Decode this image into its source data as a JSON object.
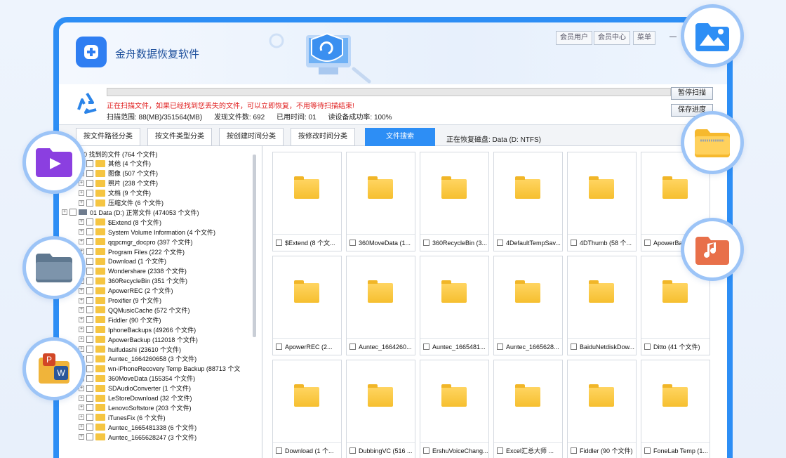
{
  "app": {
    "title": "金舟数据恢复软件"
  },
  "header_buttons": [
    "会员用户",
    "会员中心",
    "菜单"
  ],
  "scan": {
    "warning": "正在扫描文件，如果已经找到您丢失的文件，可以立即恢复，不用等待扫描结束!",
    "range": "扫描范围: 88(MB)/351564(MB)",
    "found": "发现文件数: 692",
    "elapsed": "已用时间: 01",
    "success_rate": "读设备成功率: 100%",
    "pause_label": "暂停扫描",
    "save_label": "保存进度"
  },
  "tabs": [
    {
      "label": "按文件路径分类",
      "active": false
    },
    {
      "label": "按文件类型分类",
      "active": false
    },
    {
      "label": "按创建时间分类",
      "active": false
    },
    {
      "label": "按修改时间分类",
      "active": false
    },
    {
      "label": "文件搜索",
      "active": true
    }
  ],
  "recovering_disk": "正在恢复磁盘: Data (D: NTFS)",
  "tree": [
    {
      "text": "00 找到的文件 (764 个文件)",
      "kind": "plain",
      "indent": 1
    },
    {
      "text": "其他   (4 个文件)",
      "kind": "folder",
      "indent": 2
    },
    {
      "text": "图像   (507 个文件)",
      "kind": "folder",
      "indent": 2
    },
    {
      "text": "照片   (238 个文件)",
      "kind": "folder",
      "indent": 2
    },
    {
      "text": "文档   (9 个文件)",
      "kind": "folder",
      "indent": 2
    },
    {
      "text": "压缩文件   (6 个文件)",
      "kind": "folder",
      "indent": 2
    },
    {
      "text": "01 Data (D:) 正常文件 (474053 个文件)",
      "kind": "disk",
      "indent": 0
    },
    {
      "text": "$Extend   (8 个文件)",
      "kind": "folder",
      "indent": 2
    },
    {
      "text": "System Volume Information   (4 个文件)",
      "kind": "folder",
      "indent": 2
    },
    {
      "text": "qqpcmgr_docpro   (397 个文件)",
      "kind": "folder",
      "indent": 2
    },
    {
      "text": "Program Files   (222 个文件)",
      "kind": "folder",
      "indent": 2
    },
    {
      "text": "Download   (1 个文件)",
      "kind": "folder",
      "indent": 2
    },
    {
      "text": "Wondershare   (2338 个文件)",
      "kind": "folder",
      "indent": 2
    },
    {
      "text": "360RecycleBin   (351 个文件)",
      "kind": "folder",
      "indent": 2
    },
    {
      "text": "ApowerREC   (2 个文件)",
      "kind": "folder",
      "indent": 2
    },
    {
      "text": "Proxifier   (9 个文件)",
      "kind": "folder",
      "indent": 2
    },
    {
      "text": "QQMusicCache   (572 个文件)",
      "kind": "folder",
      "indent": 2
    },
    {
      "text": "Fiddler   (90 个文件)",
      "kind": "folder",
      "indent": 2
    },
    {
      "text": "IphoneBackups   (49266 个文件)",
      "kind": "folder",
      "indent": 2
    },
    {
      "text": "ApowerBackup   (112018 个文件)",
      "kind": "folder",
      "indent": 2
    },
    {
      "text": "huifudashi   (23610 个文件)",
      "kind": "folder",
      "indent": 2
    },
    {
      "text": "Auntec_1664260658   (3 个文件)",
      "kind": "folder",
      "indent": 2
    },
    {
      "text": "wn-iPhoneRecovery Temp Backup   (88713 个文",
      "kind": "folder",
      "indent": 2
    },
    {
      "text": "360MoveData   (155354 个文件)",
      "kind": "folder",
      "indent": 2
    },
    {
      "text": "SDAudioConverter   (1 个文件)",
      "kind": "folder",
      "indent": 2
    },
    {
      "text": "LeStoreDownload   (32 个文件)",
      "kind": "folder",
      "indent": 2
    },
    {
      "text": "LenovoSoftstore   (203 个文件)",
      "kind": "folder",
      "indent": 2
    },
    {
      "text": "iTunesFix   (6 个文件)",
      "kind": "folder",
      "indent": 2
    },
    {
      "text": "Auntec_1665481338   (6 个文件)",
      "kind": "folder",
      "indent": 2
    },
    {
      "text": "Auntec_1665628247   (3 个文件)",
      "kind": "folder",
      "indent": 2
    }
  ],
  "tiles": [
    "$Extend (8 个文...",
    "360MoveData (1...",
    "360RecycleBin (3...",
    "4DefaultTempSav...",
    "4DThumb (58 个...",
    "ApowerBackup",
    "ApowerREC (2...",
    "Auntec_1664260...",
    "Auntec_1665481...",
    "Auntec_1665628...",
    "BaiduNetdiskDow...",
    "Ditto (41 个文件)",
    "Download (1 个...",
    "DubbingVC (516 ...",
    "ErshuVoiceChang...",
    "Excel汇总大师 ...",
    "Fiddler (90 个文件)",
    "FoneLab Temp (1..."
  ],
  "badges": [
    {
      "name": "photo-icon",
      "color": "#2d8ef5"
    },
    {
      "name": "zip-folder-icon",
      "color": "#f6b92e"
    },
    {
      "name": "music-folder-icon",
      "color": "#e8704a"
    },
    {
      "name": "video-folder-icon",
      "color": "#8b3fe0"
    },
    {
      "name": "folder-icon",
      "color": "#5f7890"
    },
    {
      "name": "office-docs-icon",
      "color": "#f0b43a"
    }
  ]
}
